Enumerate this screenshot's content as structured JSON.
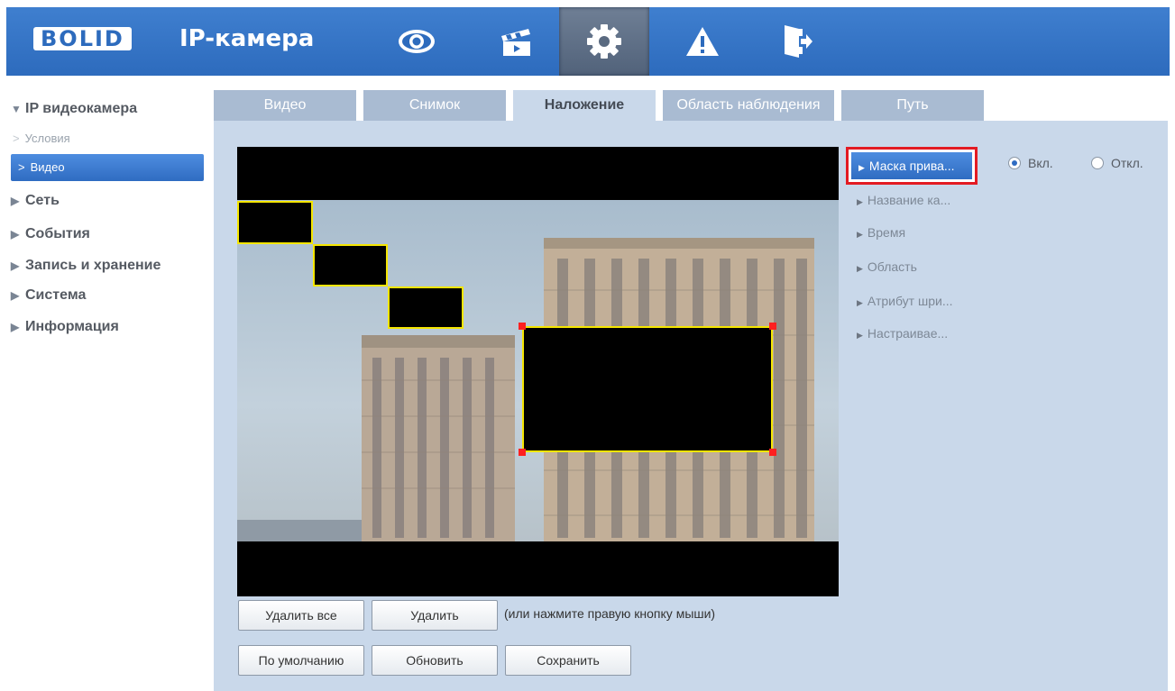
{
  "header": {
    "logo": "BOLID",
    "product": "IP-камера",
    "nav_icons": [
      "eye-icon",
      "clapperboard-icon",
      "gear-icon",
      "warning-icon",
      "logout-icon"
    ],
    "active_nav": "gear-icon",
    "colors": {
      "bar": "#2d6bbd",
      "active": "#5a6a80"
    }
  },
  "sidebar": {
    "group_expanded": "IP видеокамера",
    "sub_items": [
      "Условия",
      "Видео"
    ],
    "selected_sub": "Видео",
    "groups": [
      "Сеть",
      "События",
      "Запись и хранение",
      "Система",
      "Информация"
    ]
  },
  "tabs": [
    {
      "label": "Видео"
    },
    {
      "label": "Снимок"
    },
    {
      "label": "Наложение",
      "active": true
    },
    {
      "label": "Область наблюдения"
    },
    {
      "label": "Путь"
    }
  ],
  "menu": {
    "active": "Маска прива...",
    "items": [
      "Название ка...",
      "Время",
      "Область",
      "Атрибут шри...",
      "Настраивае..."
    ]
  },
  "toggle": {
    "on_label": "Вкл.",
    "off_label": "Откл.",
    "selected": "on"
  },
  "buttons": {
    "delete_all": "Удалить все",
    "delete": "Удалить",
    "hint": "(или нажмите правую кнопку мыши)",
    "default": "По умолчанию",
    "refresh": "Обновить",
    "save": "Сохранить"
  },
  "colors": {
    "accent": "#2f6cc2",
    "highlight_border": "#e31b23",
    "mask_border": "#f5e600",
    "content_bg": "#c9d8ea"
  }
}
